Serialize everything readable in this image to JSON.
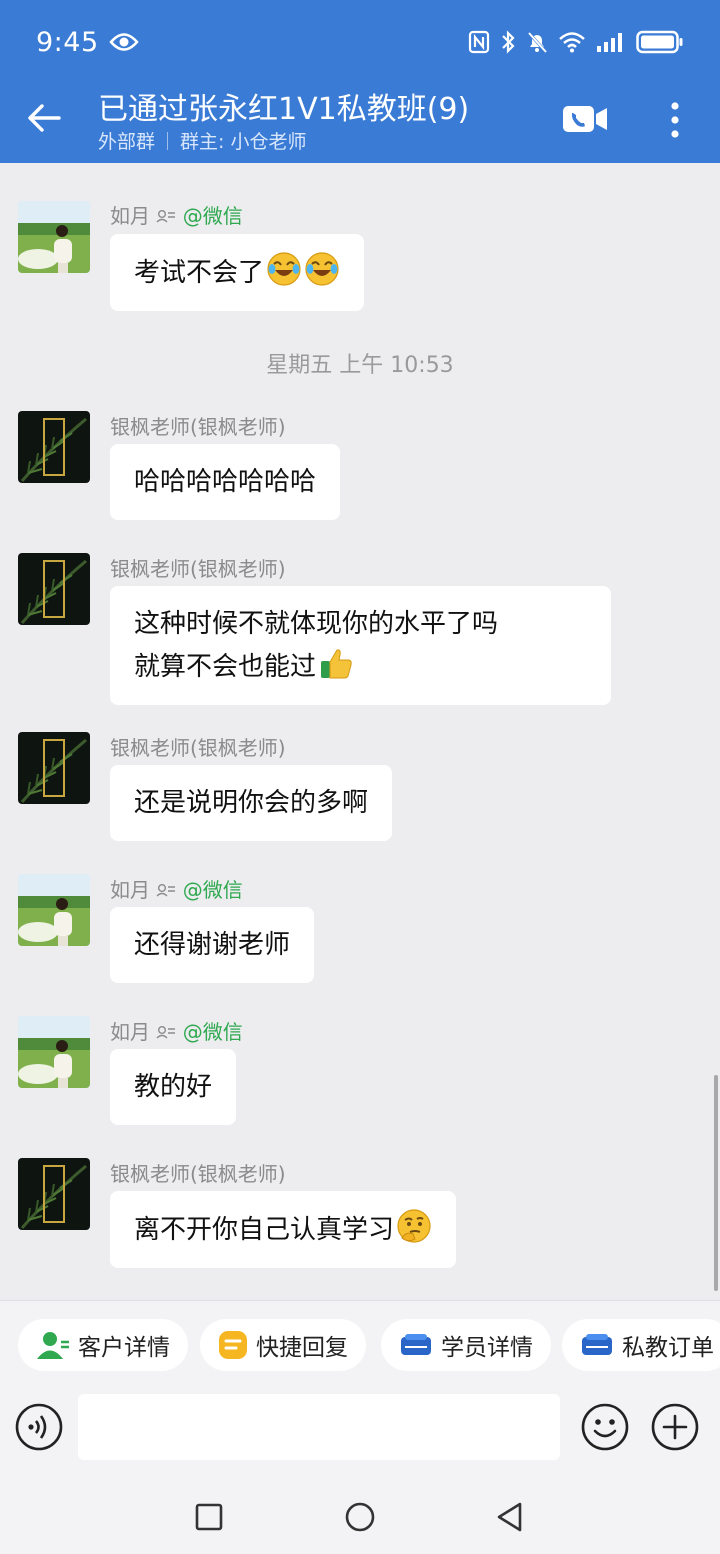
{
  "status_bar": {
    "time": "9:45"
  },
  "header": {
    "title": "已通过张永红1V1私教班(9)",
    "group_type": "外部群",
    "owner": "群主: 小仓老师"
  },
  "chat": {
    "timestamp": "星期五  上午 10:53",
    "messages": [
      {
        "sender_name": "如月",
        "sender_suffix": "@微信",
        "text": "考试不会了"
      },
      {
        "sender_name": "银枫老师(银枫老师)",
        "sender_suffix": "",
        "text": "哈哈哈哈哈哈哈"
      },
      {
        "sender_name": "银枫老师(银枫老师)",
        "sender_suffix": "",
        "text_line1": "这种时候不就体现你的水平了吗",
        "text_line2": "就算不会也能过"
      },
      {
        "sender_name": "银枫老师(银枫老师)",
        "sender_suffix": "",
        "text": "还是说明你会的多啊"
      },
      {
        "sender_name": "如月",
        "sender_suffix": "@微信",
        "text": "还得谢谢老师"
      },
      {
        "sender_name": "如月",
        "sender_suffix": "@微信",
        "text": "教的好"
      },
      {
        "sender_name": "银枫老师(银枫老师)",
        "sender_suffix": "",
        "text": "离不开你自己认真学习"
      }
    ]
  },
  "quick_actions": [
    {
      "label": "客户详情",
      "icon": "person-icon"
    },
    {
      "label": "快捷回复",
      "icon": "quick-reply-icon"
    },
    {
      "label": "学员详情",
      "icon": "student-icon"
    },
    {
      "label": "私教订单",
      "icon": "order-icon"
    }
  ],
  "input": {
    "placeholder": ""
  },
  "colors": {
    "header": "#3a7bd5",
    "wechat_green": "#2fa84f",
    "chat_bg": "#ededf0"
  }
}
